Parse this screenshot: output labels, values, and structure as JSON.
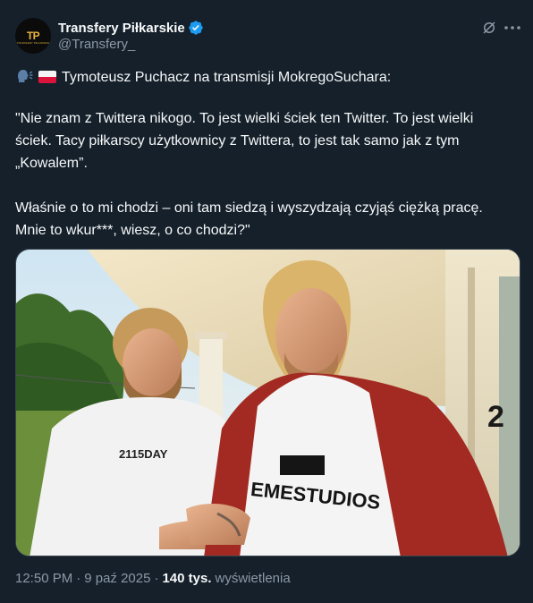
{
  "author": {
    "name": "Transfery Piłkarskie",
    "handle": "@Transfery_",
    "avatar_mark": "TP",
    "avatar_caption": "TRANSFERY PIŁKARSKIE"
  },
  "icons": {
    "verified": "verified-badge-icon",
    "grok": "grok-icon",
    "more": "more-options-icon",
    "speaking": "speaking-head-emoji",
    "flag": "poland-flag-emoji"
  },
  "colors": {
    "background": "#15202b",
    "text": "#f7f9f9",
    "muted": "#8b98a5",
    "verified": "#1d9bf0",
    "border": "#38444d"
  },
  "tweet": {
    "headline": "Tymoteusz Puchacz na transmisji MokregoSuchara:",
    "quote_line1": "\"Nie znam z Twittera nikogo. To jest wielki ściek ten Twitter. To jest wielki",
    "quote_line2": "ściek. Tacy piłkarscy użytkownicy z Twittera, to jest tak samo jak z tym",
    "quote_line3": "„Kowalem”.",
    "quote_line4": "Właśnie o to mi chodzi – oni tam siedzą i wyszydzają czyjąś ciężką pracę.",
    "quote_line5": "Mnie to wkur***, wiesz, o co chodzi?\""
  },
  "media": {
    "shirt_left_text": "2115DAY",
    "shirt_right_text": "EMESTUDIOS",
    "house_number": "2"
  },
  "meta": {
    "time": "12:50 PM",
    "date": "9 paź 2025",
    "separator": "·",
    "views_count": "140 tys.",
    "views_label": "wyświetlenia"
  }
}
